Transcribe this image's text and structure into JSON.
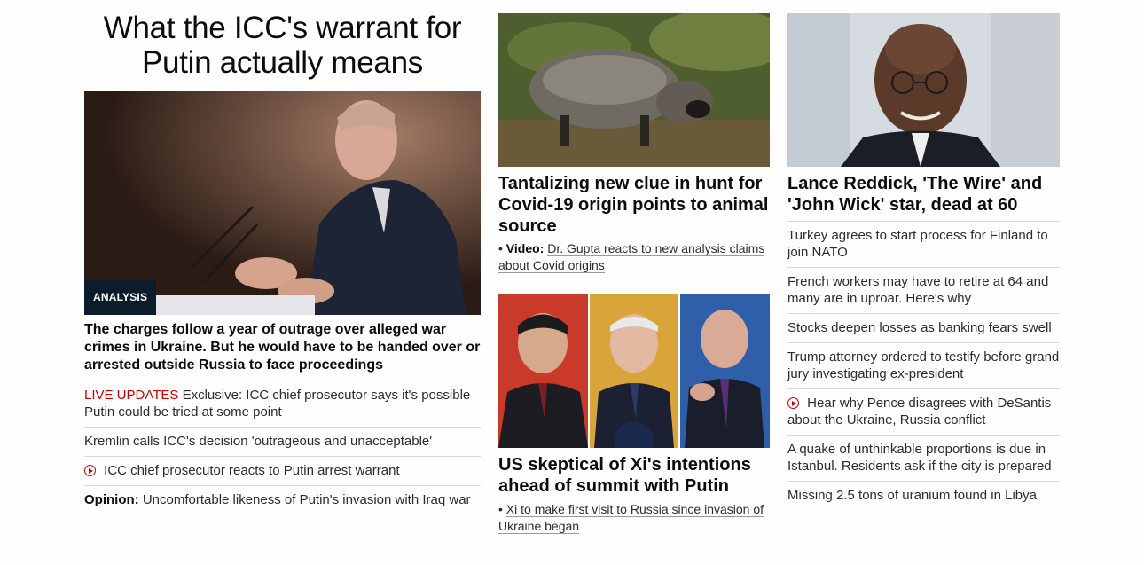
{
  "lead": {
    "headline": "What the ICC's warrant for Putin actually means",
    "badge": "ANALYSIS",
    "subhead": "The charges follow a year of outrage over alleged war crimes in Ukraine. But he would have to be handed over or arrested outside Russia to face proceedings",
    "related": [
      {
        "prefix": "LIVE UPDATES",
        "text": "Exclusive: ICC chief prosecutor says it's possible Putin could be tried at some point",
        "icon": ""
      },
      {
        "prefix": "",
        "text": "Kremlin calls ICC's decision 'outrageous and unacceptable'",
        "icon": ""
      },
      {
        "prefix": "",
        "text": "ICC chief prosecutor reacts to Putin arrest warrant",
        "icon": "play-icon"
      },
      {
        "prefix": "Opinion:",
        "text": "Uncomfortable likeness of Putin's invasion with Iraq war",
        "icon": ""
      }
    ]
  },
  "middle": {
    "story1": {
      "headline": "Tantalizing new clue in hunt for Covid-19 origin points to animal source",
      "sub_label": "Video:",
      "sub_text": "Dr. Gupta reacts to new analysis claims about Covid origins"
    },
    "story2": {
      "headline": "US skeptical of Xi's intentions ahead of summit with Putin",
      "sub_text": "Xi to make first visit to Russia since invasion of Ukraine began"
    }
  },
  "right": {
    "headline": "Lance Reddick, 'The Wire' and 'John Wick' star, dead at 60",
    "items": [
      {
        "text": "Turkey agrees to start process for Finland to join NATO",
        "icon": ""
      },
      {
        "text": "French workers may have to retire at 64 and many are in uproar. Here's why",
        "icon": ""
      },
      {
        "text": "Stocks deepen losses as banking fears swell",
        "icon": ""
      },
      {
        "text": "Trump attorney ordered to testify before grand jury investigating ex-president",
        "icon": ""
      },
      {
        "text": "Hear why Pence disagrees with DeSantis about the Ukraine, Russia conflict",
        "icon": "play-icon"
      },
      {
        "text": "A quake of unthinkable proportions is due in Istanbul. Residents ask if the city is prepared",
        "icon": ""
      },
      {
        "text": "Missing 2.5 tons of uranium found in Libya",
        "icon": ""
      }
    ]
  },
  "colors": {
    "live": "#cc0000",
    "badge_bg": "#0c1c2b",
    "divider": "#dadada"
  }
}
